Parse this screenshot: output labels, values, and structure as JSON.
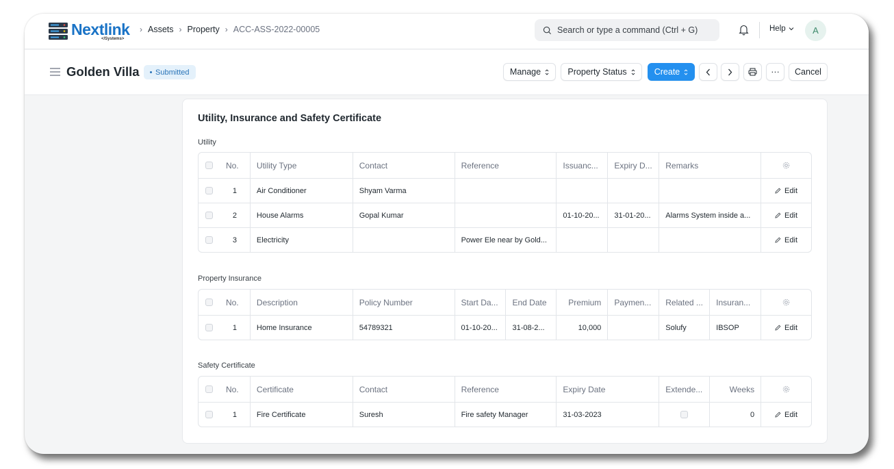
{
  "brand": {
    "name": "Nextlink",
    "tagline": "</Systems>"
  },
  "breadcrumbs": [
    "Assets",
    "Property",
    "ACC-ASS-2022-00005"
  ],
  "search": {
    "placeholder": "Search or type a command (Ctrl + G)"
  },
  "navbar": {
    "help_label": "Help",
    "avatar_initial": "A"
  },
  "doc": {
    "title": "Golden Villa",
    "status": "Submitted",
    "actions": {
      "manage": "Manage",
      "property_status": "Property Status",
      "create": "Create",
      "more": "···",
      "cancel": "Cancel"
    }
  },
  "section": {
    "title": "Utility, Insurance and Safety Certificate",
    "utility": {
      "label": "Utility",
      "columns": [
        "No.",
        "Utility Type",
        "Contact",
        "Reference",
        "Issuanc...",
        "Expiry D...",
        "Remarks"
      ],
      "rows": [
        [
          "1",
          "Air Conditioner",
          "Shyam Varma",
          "",
          "",
          "",
          ""
        ],
        [
          "2",
          "House Alarms",
          "Gopal Kumar",
          "",
          "01-10-20...",
          "31-01-20...",
          "Alarms System inside a..."
        ],
        [
          "3",
          "Electricity",
          "",
          "Power Ele near by Gold...",
          "",
          "",
          ""
        ]
      ]
    },
    "insurance": {
      "label": "Property Insurance",
      "columns": [
        "No.",
        "Description",
        "Policy Number",
        "Start Da...",
        "End Date",
        "Premium",
        "Paymen...",
        "Related ...",
        "Insuran..."
      ],
      "rows": [
        [
          "1",
          "Home Insurance",
          "54789321",
          "01-10-20...",
          "31-08-2...",
          "10,000",
          "",
          "Solufy",
          "IBSOP"
        ]
      ]
    },
    "safety": {
      "label": "Safety Certificate",
      "columns": [
        "No.",
        "Certificate",
        "Contact",
        "Reference",
        "Expiry Date",
        "Extende...",
        "Weeks"
      ],
      "rows": [
        [
          "1",
          "Fire Certificate",
          "Suresh",
          "Fire safety Manager",
          "31-03-2023",
          "",
          "0"
        ]
      ]
    },
    "edit_label": "Edit"
  },
  "icons": {
    "search": "search-icon",
    "bell": "bell-icon",
    "menu": "hamburger-icon",
    "gear": "gear-icon",
    "pencil": "pencil-icon",
    "print": "printer-icon"
  },
  "colors": {
    "primary": "#2490ef",
    "brand": "#1a73c6",
    "badge_bg": "#e4f1fb",
    "badge_text": "#2a74b8"
  }
}
